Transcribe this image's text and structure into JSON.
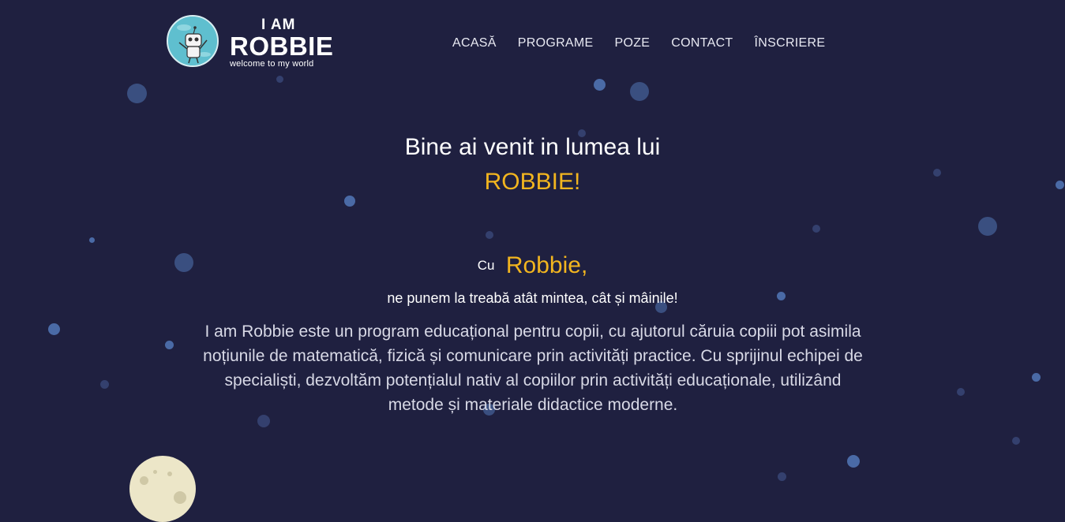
{
  "logo": {
    "line1": "I AM",
    "line2": "ROBBIE",
    "line3": "welcome to my world"
  },
  "nav": {
    "items": [
      {
        "label": "ACASĂ"
      },
      {
        "label": "PROGRAME"
      },
      {
        "label": "POZE"
      },
      {
        "label": "CONTACT"
      },
      {
        "label": "ÎNSCRIERE"
      }
    ]
  },
  "hero": {
    "welcome": "Bine ai venit in lumea lui",
    "name": "ROBBIE!"
  },
  "intro": {
    "cu": "Cu",
    "robbie": "Robbie,",
    "tagline": "ne punem la treabă atât mintea, cât și mâinile!",
    "description": "I am Robbie este un program educațional pentru copii, cu ajutorul căruia copiii pot asimila noțiunile de matematică, fizică și comunicare prin activități practice. Cu sprijinul echipei de specialiști, dezvoltăm potențialul nativ al copiilor prin activități educaționale, utilizând metode și materiale didactice moderne."
  },
  "colors": {
    "background": "#1f2040",
    "accent": "#f2b51f",
    "text": "#ffffff",
    "star": "#3a4f80"
  }
}
